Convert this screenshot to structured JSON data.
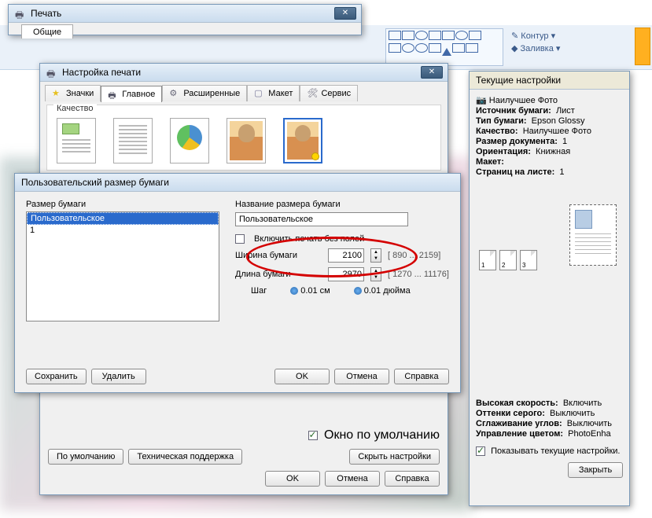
{
  "app_ribbon": {
    "contour": "Контур",
    "fill": "Заливка"
  },
  "print_dialog": {
    "title": "Печать",
    "tab_general": "Общие"
  },
  "setup_dialog": {
    "title": "Настройка печати",
    "tabs": {
      "icons": "Значки",
      "main": "Главное",
      "advanced": "Расширенные",
      "layout": "Макет",
      "service": "Сервис"
    },
    "quality_label": "Качество",
    "default_window_chk": "Окно по умолчанию",
    "btn_defaults": "По умолчанию",
    "btn_support": "Техническая поддержка",
    "btn_hide": "Скрыть настройки",
    "btn_ok": "OK",
    "btn_cancel": "Отмена",
    "btn_help": "Справка"
  },
  "paper_dialog": {
    "title": "Пользовательский размер бумаги",
    "size_list_label": "Размер бумаги",
    "list_items": [
      "Пользовательское",
      "1"
    ],
    "name_label": "Название размера бумаги",
    "name_value": "Пользовательское",
    "borderless_chk": "Включить печать без полей",
    "width_label": "Ширина бумаги",
    "width_value": "2100",
    "width_range": "[   890 ... 2159]",
    "height_label": "Длина бумаги",
    "height_value": "2970",
    "height_range": "[ 1270 ... 11176]",
    "step_label": "Шаг",
    "step_cm": "0.01 см",
    "step_in": "0.01 дюйма",
    "btn_save": "Сохранить",
    "btn_delete": "Удалить",
    "btn_ok": "OK",
    "btn_cancel": "Отмена",
    "btn_help": "Справка"
  },
  "current_panel": {
    "title": "Текущие настройки",
    "best_photo": "Наилучшее Фото",
    "rows": {
      "source_l": "Источник бумаги:",
      "source_v": "Лист",
      "type_l": "Тип бумаги:",
      "type_v": "Epson Glossy",
      "quality_l": "Качество:",
      "quality_v": "Наилучшее Фото",
      "docsize_l": "Размер документа:",
      "docsize_v": "1",
      "orient_l": "Ориентация:",
      "orient_v": "Книжная",
      "layout_l": "Макет:",
      "pps_l": "Страниц на листе:",
      "pps_v": "1",
      "speed_l": "Высокая скорость:",
      "speed_v": "Включить",
      "gray_l": "Оттенки серого:",
      "gray_v": "Выключить",
      "smooth_l": "Сглаживание углов:",
      "smooth_v": "Выключить",
      "color_l": "Управление цветом:",
      "color_v": "PhotoEnha"
    },
    "show_chk": "Показывать текущие настройки.",
    "btn_close": "Закрыть"
  }
}
